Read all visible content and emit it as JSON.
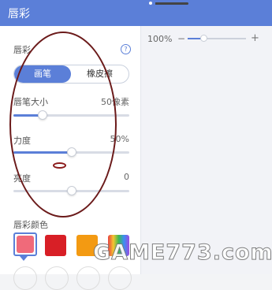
{
  "header": {
    "title": "唇彩"
  },
  "panel": {
    "section_label": "唇彩",
    "help_icon": "help-circle-icon",
    "tabs": [
      {
        "label": "画笔",
        "active": true
      },
      {
        "label": "橡皮擦",
        "active": false
      }
    ],
    "brush_size": {
      "label": "唇笔大小",
      "value": "50像素",
      "level": 0.25
    },
    "strength": {
      "label": "力度",
      "value": "50%",
      "level": 0.5
    },
    "brightness": {
      "label": "亮度",
      "value": "0",
      "level": 0.5
    },
    "color_label": "唇彩颜色",
    "colors": [
      "#f06a7a",
      "#d81f26",
      "#f39a12",
      "rainbow"
    ]
  },
  "zoom": {
    "percent": "100%",
    "minus": "−",
    "plus": "+"
  },
  "watermark": "GAME773.com",
  "accent_color": "#5b7fd8"
}
